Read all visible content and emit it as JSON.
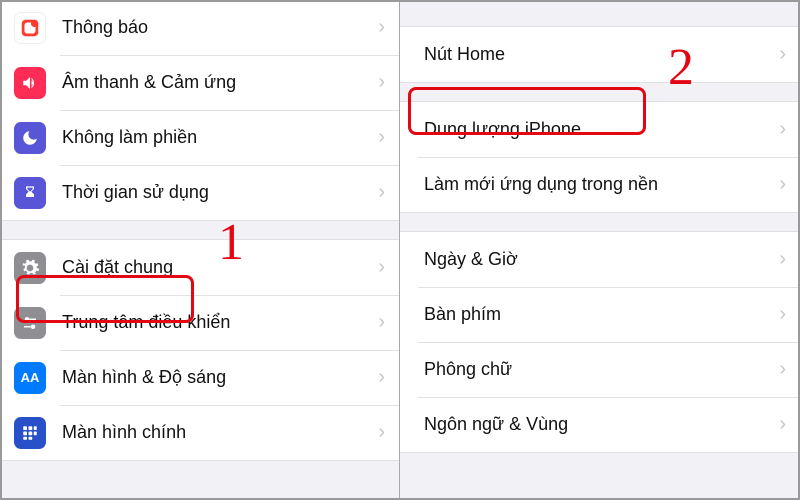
{
  "annotations": {
    "step1": "1",
    "step2": "2"
  },
  "left": {
    "group1": [
      {
        "name": "notifications",
        "label": "Thông báo",
        "icon": "notif",
        "bg": "#ff3b30"
      },
      {
        "name": "sounds",
        "label": "Âm thanh & Cảm ứng",
        "icon": "sound",
        "bg": "#ff2d55"
      },
      {
        "name": "dnd",
        "label": "Không làm phiền",
        "icon": "moon",
        "bg": "#5856d6"
      },
      {
        "name": "screentime",
        "label": "Thời gian sử dụng",
        "icon": "hourglass",
        "bg": "#5856d6"
      }
    ],
    "group2": [
      {
        "name": "general",
        "label": "Cài đặt chung",
        "icon": "gear",
        "bg": "#8e8e93"
      },
      {
        "name": "control-center",
        "label": "Trung tâm điều khiển",
        "icon": "sliders",
        "bg": "#8e8e93"
      },
      {
        "name": "display",
        "label": "Màn hình & Độ sáng",
        "icon": "aa",
        "bg": "#007aff"
      },
      {
        "name": "home",
        "label": "Màn hình chính",
        "icon": "grid",
        "bg": "#3355dd"
      }
    ]
  },
  "right": {
    "group1": [
      {
        "name": "home-button",
        "label": "Nút Home"
      }
    ],
    "group2": [
      {
        "name": "iphone-storage",
        "label": "Dung lượng iPhone"
      },
      {
        "name": "background-refresh",
        "label": "Làm mới ứng dụng trong nền"
      }
    ],
    "group3": [
      {
        "name": "date-time",
        "label": "Ngày & Giờ"
      },
      {
        "name": "keyboard",
        "label": "Bàn phím"
      },
      {
        "name": "fonts",
        "label": "Phông chữ"
      },
      {
        "name": "language-region",
        "label": "Ngôn ngữ & Vùng"
      }
    ]
  }
}
